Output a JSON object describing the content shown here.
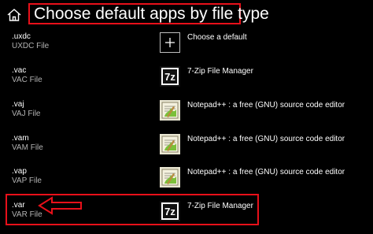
{
  "header": {
    "title": "Choose default apps by file type",
    "home_icon": "home-icon"
  },
  "colors": {
    "highlight": "#e8101a",
    "background": "#000000",
    "secondary_text": "#b3b3b3"
  },
  "rows": [
    {
      "ext": ".uxdc",
      "desc": "UXDC File",
      "app": "Choose a default",
      "icon": "plus-icon"
    },
    {
      "ext": ".vac",
      "desc": "VAC File",
      "app": "7-Zip File Manager",
      "icon": "7zip-icon"
    },
    {
      "ext": ".vaj",
      "desc": "VAJ File",
      "app": "Notepad++ : a free (GNU) source code editor",
      "icon": "notepad-plus-plus-icon"
    },
    {
      "ext": ".vam",
      "desc": "VAM File",
      "app": "Notepad++ : a free (GNU) source code editor",
      "icon": "notepad-plus-plus-icon"
    },
    {
      "ext": ".vap",
      "desc": "VAP File",
      "app": "Notepad++ : a free (GNU) source code editor",
      "icon": "notepad-plus-plus-icon"
    },
    {
      "ext": ".var",
      "desc": "VAR File",
      "app": "7-Zip File Manager",
      "icon": "7zip-icon"
    }
  ]
}
